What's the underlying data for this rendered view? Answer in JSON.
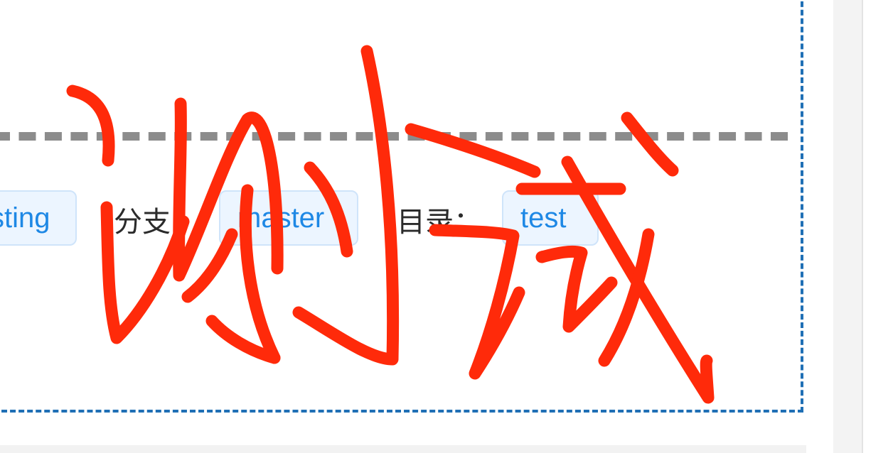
{
  "meta": {
    "project_tag": "sting",
    "branch_label": "分支：",
    "branch_tag": "master",
    "directory_label": "目录：",
    "directory_tag": "test"
  },
  "annotation": {
    "handwritten_text": "测试",
    "color": "#ff2a0a"
  },
  "colors": {
    "card_border": "#1f6fb5",
    "divider": "#8c8c8c",
    "tag_text": "#1e88e5",
    "tag_bg": "#ecf5ff",
    "tag_border": "#cfe4fa"
  }
}
